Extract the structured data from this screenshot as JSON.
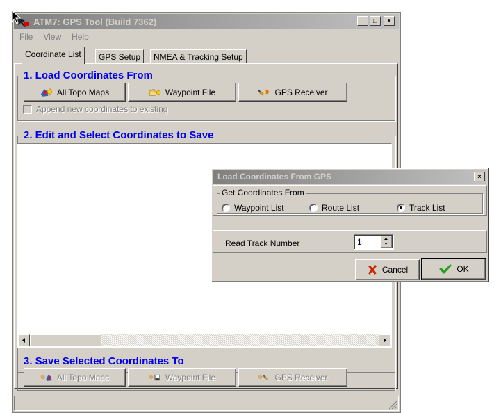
{
  "window": {
    "title": "ATM7: GPS Tool  (Build 7362)",
    "buttons": {
      "minimize": "_",
      "maximize": "□",
      "close": "×"
    }
  },
  "menu": [
    "File",
    "View",
    "Help"
  ],
  "tabs": [
    {
      "label": "Coordinate List",
      "active": true
    },
    {
      "label": "GPS Setup",
      "active": false
    },
    {
      "label": "NMEA & Tracking Setup",
      "active": false
    }
  ],
  "load": {
    "title": "1. Load Coordinates From",
    "buttons": [
      "All Topo Maps",
      "Waypoint File",
      "GPS Receiver"
    ],
    "append_label": "Append new coordinates to existing"
  },
  "edit": {
    "title": "2. Edit and Select Coordinates to Save"
  },
  "save": {
    "title": "3. Save Selected Coordinates To",
    "buttons": [
      "All Topo Maps",
      "Waypoint File",
      "GPS Receiver"
    ]
  },
  "dialog": {
    "title": "Load Coordinates From GPS",
    "close": "×",
    "group_label": "Get Coordinates From",
    "options": [
      {
        "label": "Waypoint List",
        "checked": false
      },
      {
        "label": "Route List",
        "checked": false
      },
      {
        "label": "Track List",
        "checked": true
      }
    ],
    "track_label": "Read Track Number",
    "track_value": "1",
    "cancel_label": "Cancel",
    "ok_label": "OK"
  },
  "colors": {
    "group_title": "#0000ee",
    "face": "#d4d0c8",
    "cancel_icon": "#cc2200",
    "ok_icon": "#22a022"
  }
}
